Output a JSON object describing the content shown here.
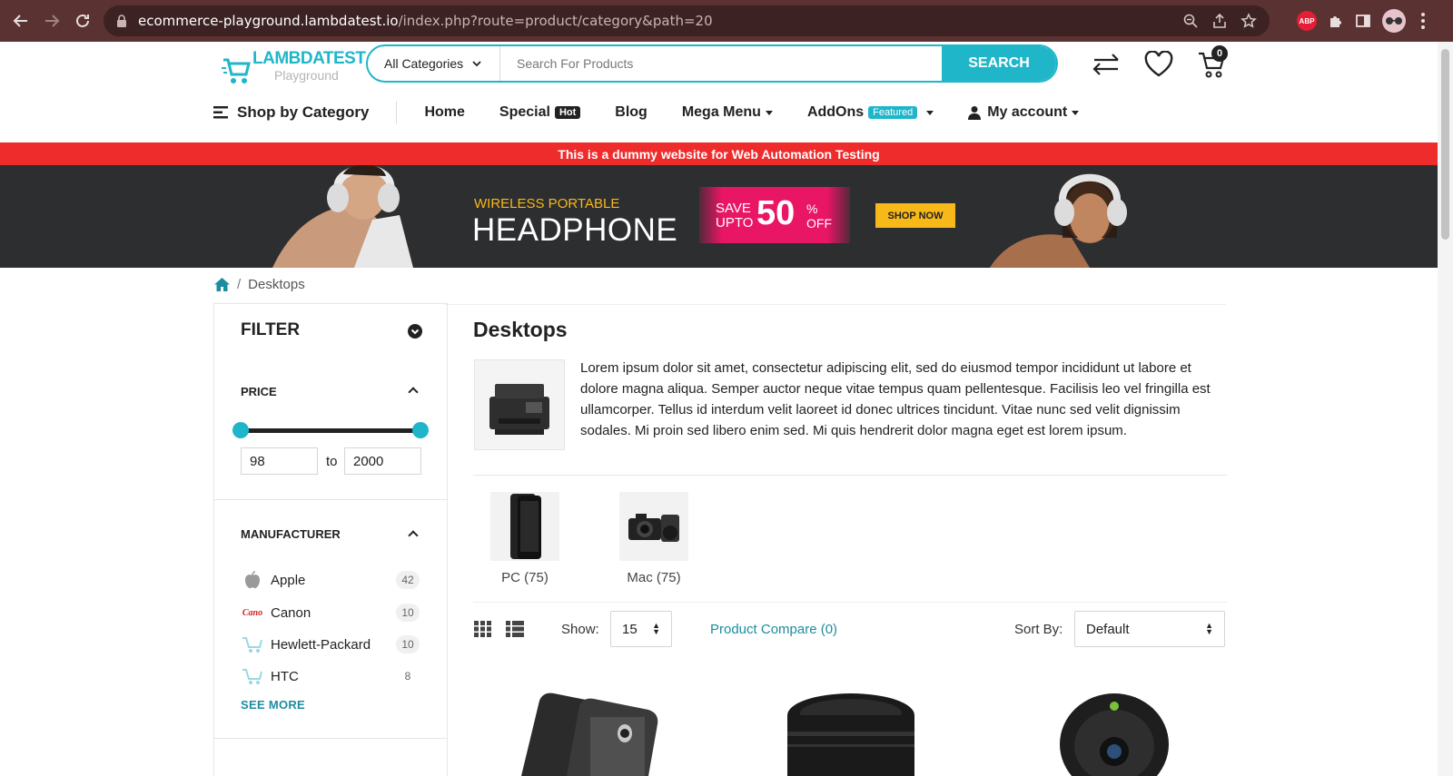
{
  "browser": {
    "url_host": "ecommerce-playground.lambdatest.io",
    "url_rest": "/index.php?route=product/category&path=20",
    "abp_label": "ABP"
  },
  "header": {
    "logo_brand": "LAMBDATEST",
    "logo_sub": "Playground",
    "category_select": "All Categories",
    "search_placeholder": "Search For Products",
    "search_button": "SEARCH",
    "cart_count": "0"
  },
  "nav": {
    "shop_by_category": "Shop by Category",
    "items": [
      {
        "label": "Home"
      },
      {
        "label": "Special",
        "badge": "Hot"
      },
      {
        "label": "Blog"
      },
      {
        "label": "Mega Menu"
      },
      {
        "label": "AddOns",
        "badge": "Featured"
      },
      {
        "label": "My account"
      }
    ]
  },
  "notice": "This is a dummy website for Web Automation Testing",
  "banner": {
    "line1": "WIRELESS PORTABLE",
    "line2": "HEADPHONE",
    "save": "SAVE",
    "upto": "UPTO",
    "number": "50",
    "percent": "%",
    "off": "OFF",
    "cta": "SHOP NOW"
  },
  "breadcrumb": {
    "separator": "/",
    "current": "Desktops"
  },
  "filter": {
    "title": "FILTER",
    "price": {
      "title": "PRICE",
      "min": "98",
      "to": "to",
      "max": "2000"
    },
    "manufacturer": {
      "title": "MANUFACTURER",
      "items": [
        {
          "name": "Apple",
          "count": "42",
          "logo": "apple-logo"
        },
        {
          "name": "Canon",
          "count": "10",
          "logo": "canon-logo",
          "logo_text": "Cano"
        },
        {
          "name": "Hewlett-Packard",
          "count": "10",
          "logo": "cart-logo"
        },
        {
          "name": "HTC",
          "count": "8",
          "logo": "cart-logo"
        }
      ],
      "see_more": "SEE MORE"
    }
  },
  "category": {
    "title": "Desktops",
    "description": "Lorem ipsum dolor sit amet, consectetur adipiscing elit, sed do eiusmod tempor incididunt ut labore et dolore magna aliqua. Semper auctor neque vitae tempus quam pellentesque. Facilisis leo vel fringilla est ullamcorper. Tellus id interdum velit laoreet id donec ultrices tincidunt. Vitae nunc sed velit dignissim sodales. Mi proin sed libero enim sed. Mi quis hendrerit dolor magna eget est lorem ipsum.",
    "subcategories": [
      {
        "label": "PC (75)"
      },
      {
        "label": "Mac (75)"
      }
    ]
  },
  "toolbar": {
    "show_label": "Show:",
    "show_value": "15",
    "compare": "Product Compare (0)",
    "sort_label": "Sort By:",
    "sort_value": "Default"
  },
  "colors": {
    "accent": "#1fb6c9",
    "notice": "#ee2c2c",
    "banner_bg": "#2d2e30",
    "chrome": "#5b3232"
  }
}
